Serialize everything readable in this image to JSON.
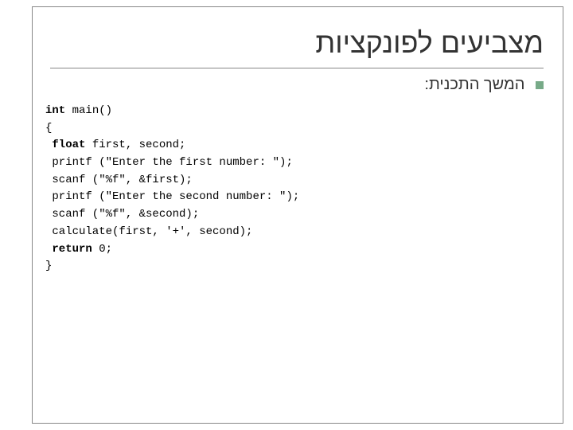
{
  "title": "מצביעים לפונקציות",
  "subtitle": "המשך התכנית:",
  "code": {
    "l1_kw": "int",
    "l1_rest": " main()",
    "l2": "{",
    "l3_kw": " float",
    "l3_rest": " first, second;",
    "l4": " printf (\"Enter the first number: \");",
    "l5": " scanf (\"%f\", &first);",
    "l6": " printf (\"Enter the second number: \");",
    "l7": " scanf (\"%f\", &second);",
    "l8": " calculate(first, '+', second);",
    "l9_kw": " return",
    "l9_rest": " 0;",
    "l10": "}"
  }
}
